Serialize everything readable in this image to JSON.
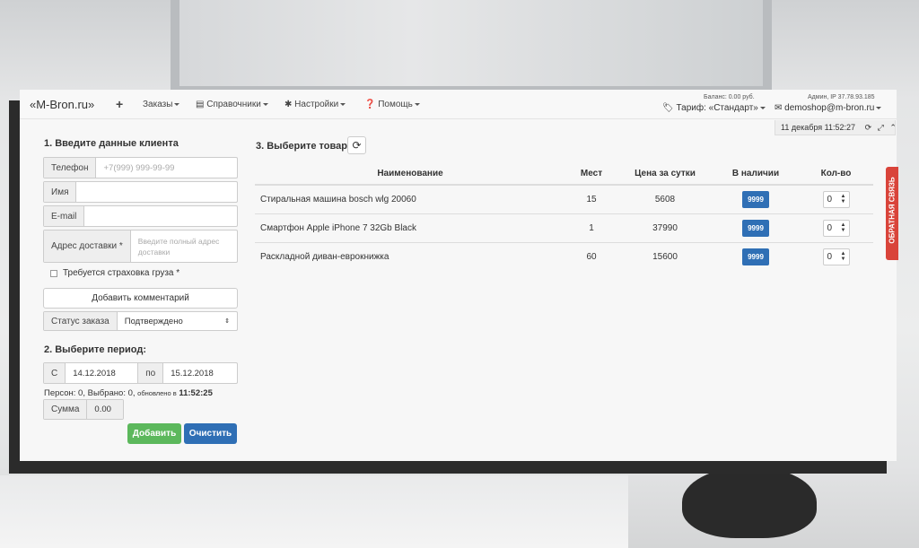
{
  "navbar": {
    "brand": "«M-Bron.ru»",
    "plus": "+",
    "orders": "Заказы",
    "directories": "Справочники",
    "settings": "Настройки",
    "help": "Помощь",
    "balance": "Баланс: 0.00 руб.",
    "tariff": "Тариф: «Стандарт»",
    "admin": "Админ, IP 37.78.93.185",
    "email": "demoshop@m-bron.ru",
    "datetime": "11 декабря 11:52:27"
  },
  "client": {
    "heading": "1. Введите данные клиента",
    "phone_label": "Телефон",
    "phone_placeholder": "+7(999) 999-99-99",
    "name_label": "Имя",
    "email_label": "E-mail",
    "address_label": "Адрес доставки *",
    "address_placeholder": "Введите полный адрес доставки",
    "insurance_label": "Требуется страховка груза *",
    "comment_button": "Добавить комментарий",
    "status_label": "Статус заказа",
    "status_value": "Подтверждено"
  },
  "period": {
    "heading": "2. Выберите период:",
    "from_label": "С",
    "from_value": "14.12.2018",
    "to_label": "по",
    "to_value": "15.12.2018",
    "info_prefix": "Персон: 0, Выбрано: 0,",
    "info_updated": "обновлено в",
    "info_time": "11:52:25",
    "sum_label": "Сумма",
    "sum_value": "0.00",
    "add_button": "Добавить",
    "clear_button": "Очистить"
  },
  "products": {
    "heading": "3. Выберите товар",
    "columns": [
      "Наименование",
      "Мест",
      "Цена за сутки",
      "В наличии",
      "Кол-во"
    ],
    "rows": [
      {
        "name": "Стиральная машина bosch wlg 20060",
        "places": "15",
        "price": "5608",
        "stock": "9999",
        "qty": "0"
      },
      {
        "name": "Смартфон Apple iPhone 7 32Gb Black",
        "places": "1",
        "price": "37990",
        "stock": "9999",
        "qty": "0"
      },
      {
        "name": "Раскладной диван-еврокнижка",
        "places": "60",
        "price": "15600",
        "stock": "9999",
        "qty": "0"
      }
    ]
  },
  "feedback": "ОБРАТНАЯ СВЯЗЬ",
  "colors": {
    "primary": "#2f6fb5",
    "success": "#5cb85c",
    "feedback": "#d9443a"
  }
}
